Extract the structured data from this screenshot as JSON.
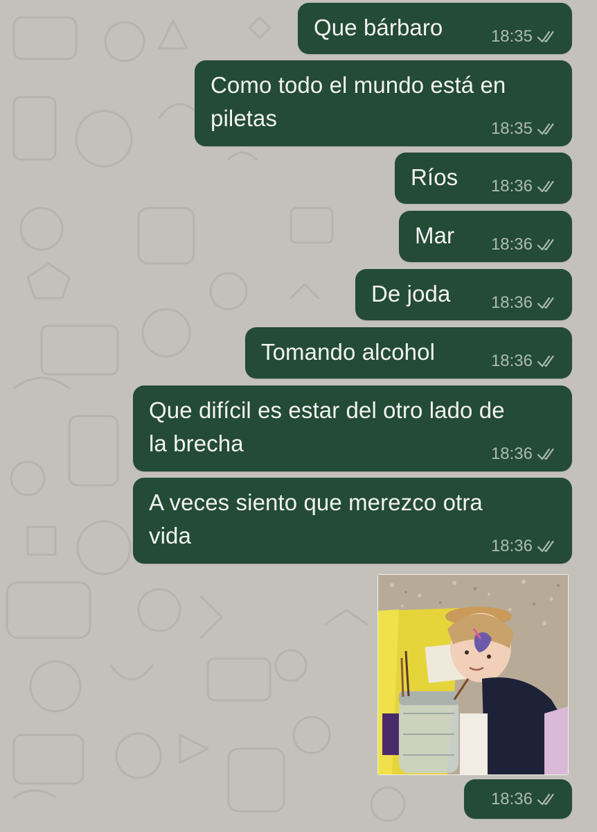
{
  "messages": [
    {
      "text": "Que bárbaro",
      "time": "18:35",
      "status": "read",
      "direction": "outgoing"
    },
    {
      "text": "Como todo el mundo está en\npiletas",
      "time": "18:35",
      "status": "read",
      "direction": "outgoing"
    },
    {
      "text": "Ríos",
      "time": "18:36",
      "status": "read",
      "direction": "outgoing"
    },
    {
      "text": "Mar",
      "time": "18:36",
      "status": "read",
      "direction": "outgoing"
    },
    {
      "text": "De joda",
      "time": "18:36",
      "status": "read",
      "direction": "outgoing"
    },
    {
      "text": "Tomando alcohol",
      "time": "18:36",
      "status": "read",
      "direction": "outgoing"
    },
    {
      "text": "Que difícil es estar del otro lado de\nla brecha",
      "time": "18:36",
      "status": "read",
      "direction": "outgoing"
    },
    {
      "text": "A veces siento que merezco otra\nvida",
      "time": "18:36",
      "status": "read",
      "direction": "outgoing"
    },
    {
      "type": "photo",
      "time": "18:36",
      "status": "read",
      "direction": "outgoing"
    }
  ],
  "icons": {
    "read_receipt": "double-check-icon"
  },
  "colors": {
    "wallpaper": "#c4c1bb",
    "outgoing_bubble": "#234b35",
    "bubble_text": "#f3f3f1",
    "timestamp": "#aebbb2"
  }
}
